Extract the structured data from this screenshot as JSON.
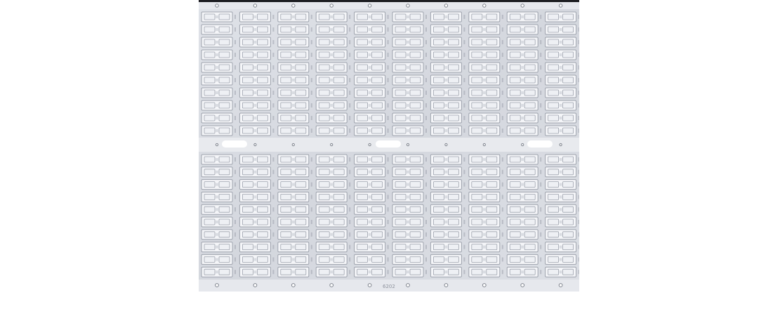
{
  "image": {
    "subject": "leadframe-strip-photo",
    "colors": {
      "background": "#ffffff",
      "frame_top_edge": "#1d1e22",
      "panel": "#d9dce2",
      "panel_highlight": "#eef0f4",
      "slot_edge": "#9ea3ad",
      "slot_inner": "#f4f5f8",
      "hole": "#ffffff",
      "rail_dot": "#7d828c"
    },
    "upper_block": {
      "rows": 10,
      "columns": 10
    },
    "lower_block": {
      "rows": 10,
      "columns": 10
    },
    "stamp_text": "6202"
  }
}
